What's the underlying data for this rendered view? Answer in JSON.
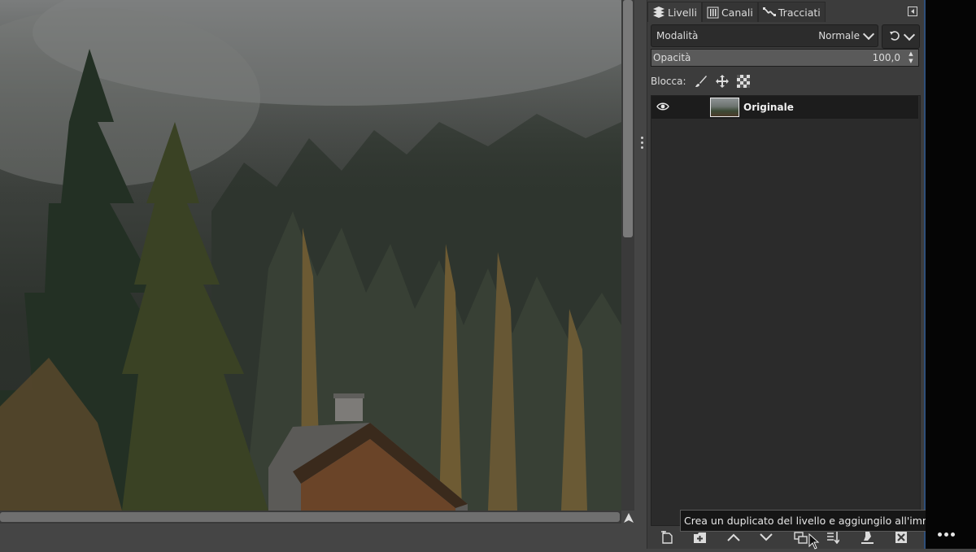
{
  "dock": {
    "tabs": [
      {
        "label": "Livelli",
        "icon": "layers-icon",
        "active": true
      },
      {
        "label": "Canali",
        "icon": "channels-icon",
        "active": false
      },
      {
        "label": "Tracciati",
        "icon": "paths-icon",
        "active": false
      }
    ],
    "mode": {
      "label": "Modalità",
      "value": "Normale"
    },
    "opacity": {
      "label": "Opacità",
      "value": "100,0"
    },
    "lock": {
      "label": "Blocca:"
    },
    "layers": [
      {
        "name": "Originale",
        "visible": true
      }
    ],
    "tooltip": "Crea un duplicato del livello e aggiungilo all'immagine",
    "accent": "#2f4f7a"
  },
  "icons": [
    "eye-icon",
    "brush-lock-icon",
    "move-lock-icon",
    "alpha-lock-icon",
    "new-layer-icon",
    "new-group-icon",
    "raise-icon",
    "lower-icon",
    "duplicate-icon",
    "merge-icon",
    "anchor-icon",
    "delete-icon",
    "more-icon",
    "navigate-icon"
  ]
}
